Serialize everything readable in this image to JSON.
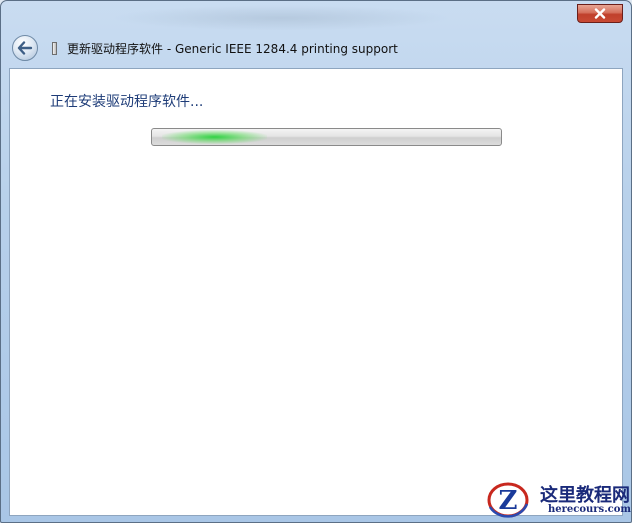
{
  "window": {
    "title": "更新驱动程序软件 - Generic IEEE 1284.4 printing support"
  },
  "icons": {
    "close": "close-icon",
    "back": "back-arrow-icon",
    "device": "device-icon"
  },
  "content": {
    "heading": "正在安装驱动程序软件..."
  },
  "progress": {
    "state": "indeterminate",
    "color": "#2fcf3c"
  },
  "watermark": {
    "name": "这里教程网",
    "url": "herecours.com"
  },
  "colors": {
    "heading": "#1e3c78",
    "frame": "#b7d0ea",
    "close_button": "#c0402c"
  }
}
